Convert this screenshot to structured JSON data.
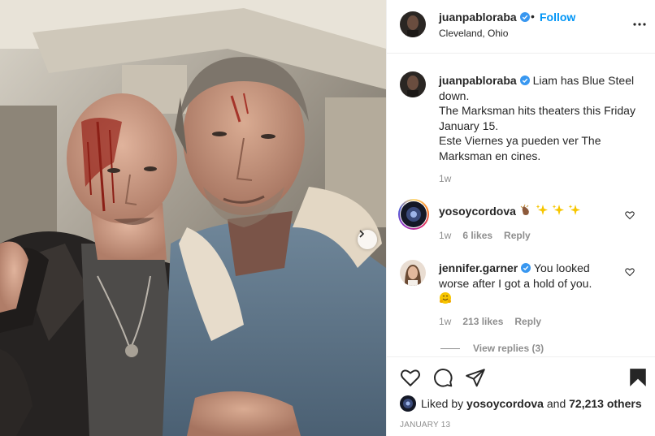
{
  "header": {
    "username": "juanpabloraba",
    "dot": "•",
    "follow_label": "Follow",
    "location": "Cleveland, Ohio",
    "more_label": "•••"
  },
  "caption": {
    "username": "juanpabloraba",
    "lines": [
      "Liam has Blue Steel",
      "down.",
      "The Marksman hits theaters this Friday",
      "January 15.",
      "Este Viernes ya pueden ver The",
      "Marksman en cines."
    ],
    "time": "1w"
  },
  "comments": [
    {
      "username": "yosoycordova",
      "text_emojis": [
        "clap-medium-dark-skin-tone",
        "sparkles",
        "sparkles",
        "sparkles"
      ],
      "time": "1w",
      "likes": "6 likes",
      "reply": "Reply"
    },
    {
      "username": "jennifer.garner",
      "lines": [
        "You looked",
        "worse after I got a hold of you."
      ],
      "emoji": "hugging-face",
      "time": "1w",
      "likes": "213 likes",
      "reply": "Reply",
      "view_replies": "View replies (3)"
    }
  ],
  "likes": {
    "prefix": "Liked by",
    "first_user": "yosoycordova",
    "conjunction": "and",
    "others": "72,213 others"
  },
  "date": "JANUARY 13",
  "colors": {
    "accent": "#0095f6",
    "verified": "#3897f0",
    "secondary_text": "#8e8e8e",
    "border": "#efefef"
  }
}
